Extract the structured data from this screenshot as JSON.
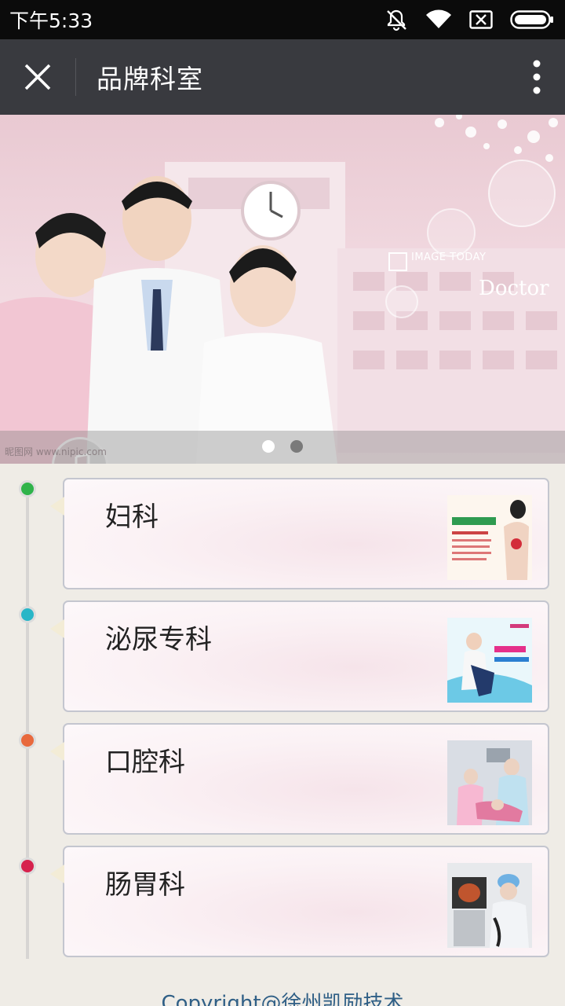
{
  "status_bar": {
    "time": "下午5:33",
    "icons": [
      "mute-icon",
      "wifi-icon",
      "sim-icon",
      "battery-icon"
    ]
  },
  "title_bar": {
    "title": "品牌科室",
    "close_icon": "close-icon",
    "more_icon": "more-vertical-icon"
  },
  "banner": {
    "image_text_doctor": "Doctor",
    "image_text_small": "IMAGE TODAY",
    "watermark": "昵图网 www.nipic.com",
    "slide_count": 2,
    "active_slide": 1
  },
  "departments": [
    {
      "name": "妇科",
      "dot_color": "#2fb34a"
    },
    {
      "name": "泌尿专科",
      "dot_color": "#28b6c7"
    },
    {
      "name": "口腔科",
      "dot_color": "#e8693d"
    },
    {
      "name": "肠胃科",
      "dot_color": "#d6224d"
    }
  ],
  "footer": {
    "copyright": "Copyright@徐州凯励技术"
  }
}
